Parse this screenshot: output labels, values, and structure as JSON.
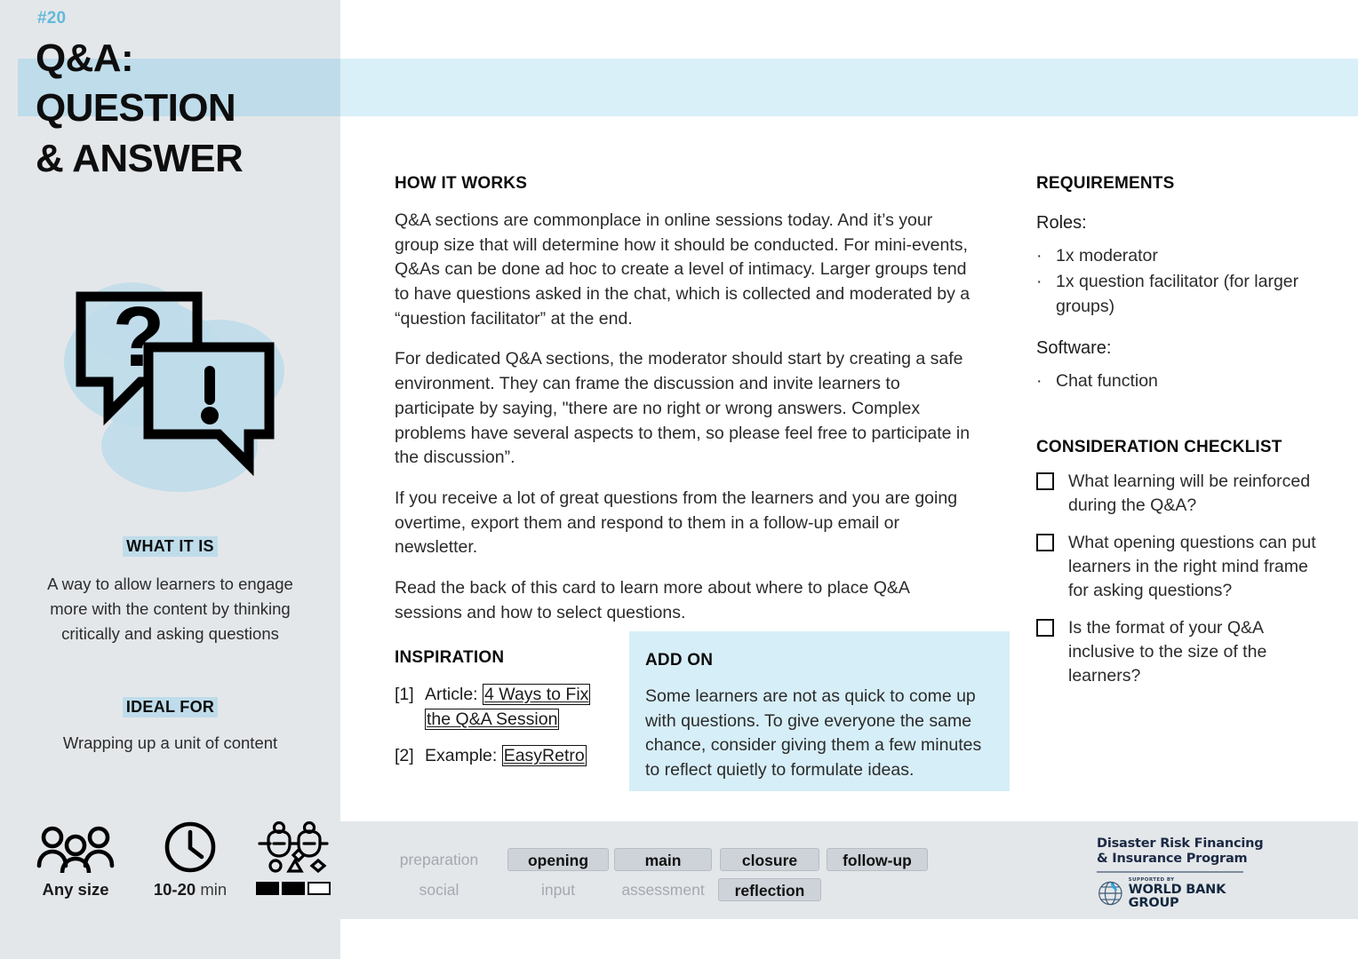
{
  "card": {
    "number": "#20",
    "title_line1": "Q&A:",
    "title_line2": "QUESTION",
    "title_line3": "& ANSWER",
    "illustration_icon": "speech-bubbles-question-exclamation-icon"
  },
  "sidebar": {
    "what_it_is_label": "WHAT IT IS",
    "what_it_is_text": "A way to allow learners to engage more with the content by thinking critically and asking questions",
    "ideal_for_label": "IDEAL FOR",
    "ideal_for_text": "Wrapping up a unit of content",
    "meta": {
      "size_icon": "group-of-people-icon",
      "size_label_bold": "Any size",
      "size_label_rest": "",
      "time_icon": "clock-icon",
      "time_label_bold": "10-20",
      "time_label_rest": " min",
      "difficulty_icon": "facilitation-complexity-icon",
      "difficulty_filled": 2,
      "difficulty_total": 3
    }
  },
  "main": {
    "how_it_works_heading": "HOW IT WORKS",
    "paragraphs": [
      "Q&A sections are commonplace in online sessions today. And it’s your group size that will determine how it should be conducted. For mini-events, Q&As can be done ad hoc to create a level of intimacy. Larger groups tend to have questions asked in the chat, which is collected and moderated by a “question facilitator” at the end.",
      "For dedicated Q&A sections, the moderator should start by creating a safe environment. They can frame the discussion and invite learners to participate by saying, \"there are no right or wrong answers. Complex problems have several aspects to them, so please feel free to participate in the discussion”.",
      "If you receive a lot of great questions from the learners and you are going overtime, export them and respond to them in a follow-up email or newsletter.",
      "Read the back of this card to learn more about where to place Q&A sessions and how to select questions."
    ]
  },
  "inspiration": {
    "heading": "INSPIRATION",
    "items": [
      {
        "index": "[1]",
        "prefix": "Article: ",
        "link": "4 Ways to Fix the Q&A Session"
      },
      {
        "index": "[2]",
        "prefix": "Example: ",
        "link": "EasyRetro"
      }
    ]
  },
  "addon": {
    "heading": "ADD ON",
    "text": "Some learners are not as quick to come up with questions. To give everyone the same chance, consider giving them a few minutes to reflect quietly to formulate ideas."
  },
  "requirements": {
    "heading": "REQUIREMENTS",
    "roles_label": "Roles:",
    "roles": [
      "1x moderator",
      "1x question facilitator (for larger groups)"
    ],
    "software_label": "Software:",
    "software": [
      "Chat function"
    ]
  },
  "checklist": {
    "heading": "CONSIDERATION CHECKLIST",
    "items": [
      "What learning will be reinforced during the Q&A?",
      "What opening questions can put learners in the right mind frame for asking questions?",
      "Is the format of your Q&A inclusive to the size of the learners?"
    ]
  },
  "footer": {
    "row1": [
      {
        "label": "preparation",
        "active": false
      },
      {
        "label": "opening",
        "active": true
      },
      {
        "label": "main",
        "active": true
      },
      {
        "label": "closure",
        "active": true
      },
      {
        "label": "follow-up",
        "active": true
      }
    ],
    "row2": [
      {
        "label": "social",
        "active": false
      },
      {
        "label": "input",
        "active": false
      },
      {
        "label": "assessment",
        "active": false
      },
      {
        "label": "reflection",
        "active": true
      }
    ],
    "logo": {
      "line1": "Disaster Risk Financing",
      "line2": "& Insurance Program",
      "supported_by": "SUPPORTED BY",
      "org": "WORLD BANK GROUP",
      "globe_icon": "world-bank-globe-icon"
    }
  },
  "colors": {
    "sidebar_bg": "#e4e7ea",
    "band_left": "#bfdcea",
    "band_right": "#daf0f8",
    "accent_number": "#64b9d8",
    "addon_bg": "#d6eef7",
    "tag_active_bg": "#ced3d9",
    "tag_inactive_text": "#a4a9b0"
  }
}
